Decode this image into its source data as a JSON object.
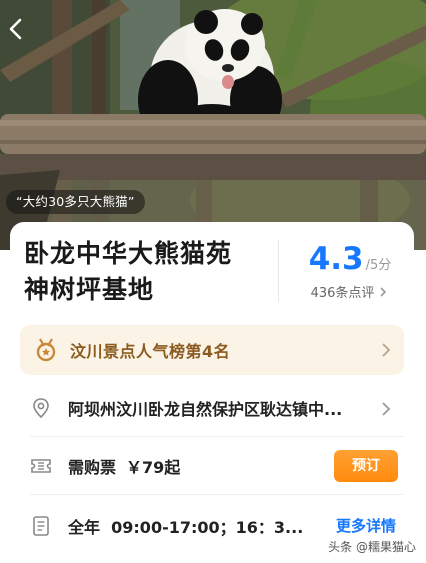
{
  "hero": {
    "caption": "“大约30多只大熊猫”",
    "back_icon": "chevron-left-icon"
  },
  "attraction": {
    "title_line1": "卧龙中华大熊猫苑",
    "title_line2": "神树坪基地",
    "rating": "4.3",
    "rating_max": "/5分",
    "review_count": "436条点评"
  },
  "rank": {
    "text": "汶川景点人气榜第4名",
    "icon": "medal-icon"
  },
  "address": {
    "text": "阿坝州汶川卧龙自然保护区耿达镇中...",
    "icon": "location-pin-icon"
  },
  "ticket": {
    "label": "需购票",
    "price": "￥79起",
    "button": "预订",
    "icon": "ticket-icon"
  },
  "hours": {
    "text": "全年  09:00-17:00；16：3...",
    "link": "更多详情",
    "icon": "document-icon"
  },
  "watermark": "头条 @糯果猫心",
  "colors": {
    "accent_blue": "#1677ff",
    "book_orange": "#ff8a0d",
    "rank_bg": "#fbf3e6",
    "rank_text": "#8a5a1e"
  }
}
